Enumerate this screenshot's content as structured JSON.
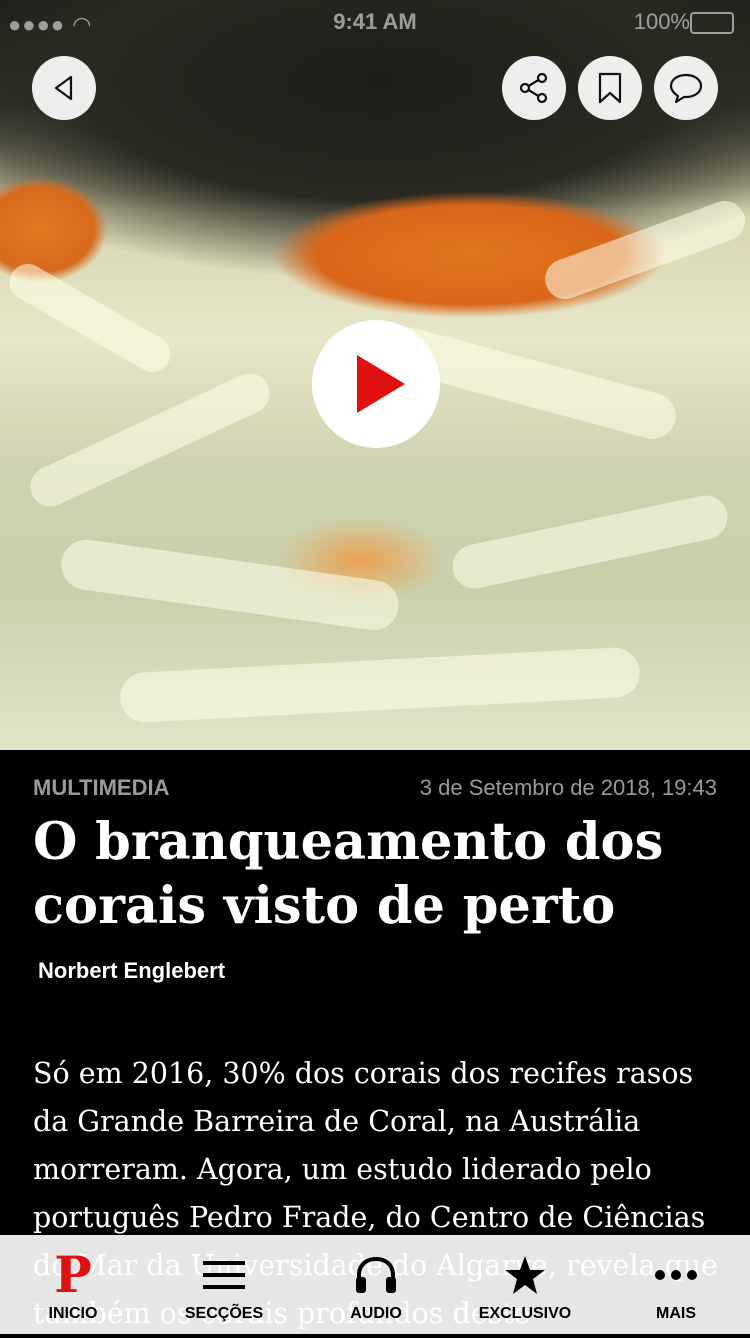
{
  "status_bar": {
    "time": "9:41 AM",
    "battery": "100%"
  },
  "hero": {
    "media": "video-thumbnail-clownfish-coral"
  },
  "actions": {
    "back": "back-icon",
    "share": "share-icon",
    "bookmark": "bookmark-icon",
    "comments": "comment-icon",
    "play": "play-icon",
    "play_color": "#e01010"
  },
  "article": {
    "kicker": "MULTIMEDIA",
    "date": "3 de Setembro de 2018, 19:43",
    "title": "O branqueamento dos corais visto de perto",
    "author": "Norbert Englebert",
    "body": "Só em 2016, 30% dos corais dos recifes rasos da Grande Barreira de Coral, na Austrália morreram. Agora, um estudo liderado pelo português Pedro Frade, do Centro de Ciências do Mar da Universidade do Algarve, revela que também os corais profundos deste"
  },
  "tabbar": {
    "accent": "#e01010",
    "items": [
      {
        "label": "INICIO",
        "icon": "publico-logo-icon"
      },
      {
        "label": "SECÇÕES",
        "icon": "menu-icon"
      },
      {
        "label": "AUDIO",
        "icon": "headphones-icon"
      },
      {
        "label": "EXCLUSIVO",
        "icon": "star-icon"
      },
      {
        "label": "MAIS",
        "icon": "more-icon"
      }
    ]
  }
}
